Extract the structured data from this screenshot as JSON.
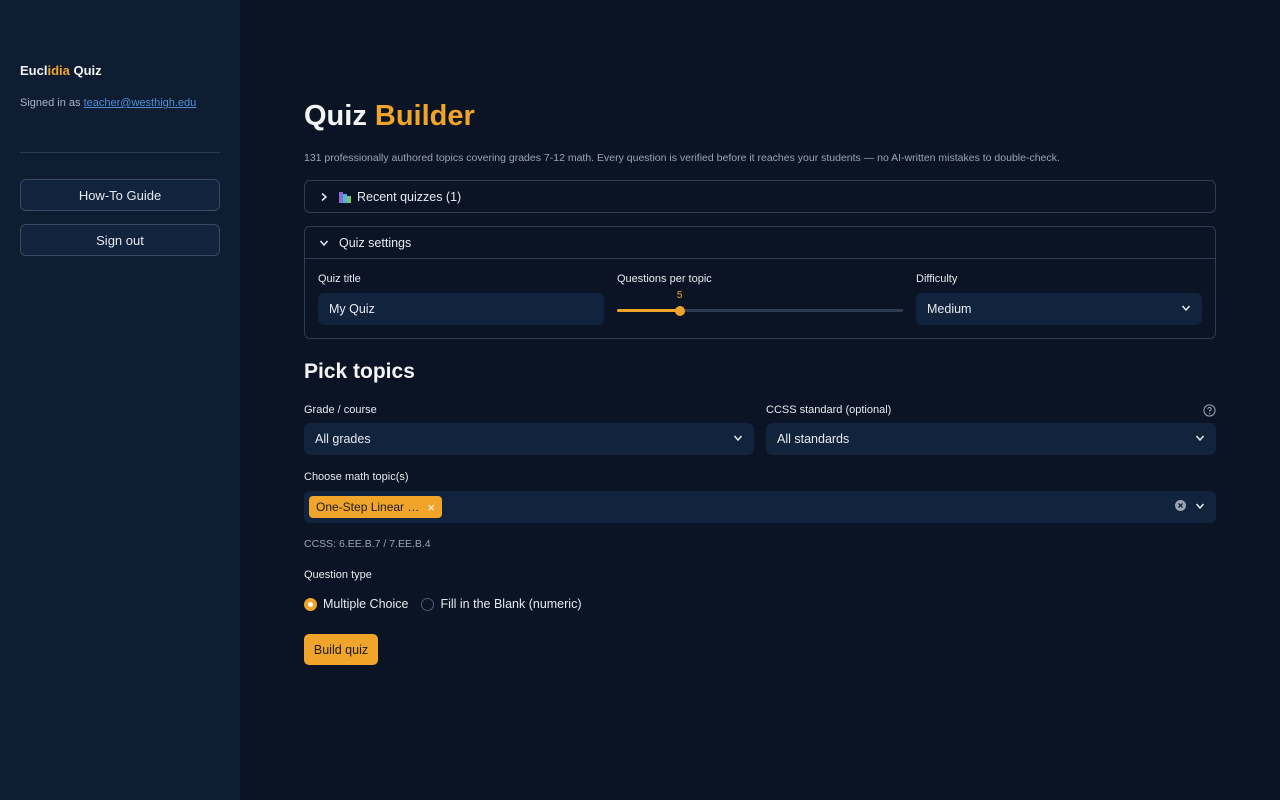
{
  "sidebar": {
    "brand_part1": "Eucl",
    "brand_accent": "idia",
    "brand_part2": " Quiz",
    "signed_prefix": "Signed in as ",
    "signed_email": "teacher@westhigh.edu",
    "howto_label": "How-To Guide",
    "signout_label": "Sign out"
  },
  "header": {
    "title_main": "Quiz ",
    "title_accent": "Builder",
    "subtitle": "131 professionally authored topics covering grades 7-12 math. Every question is verified before it reaches your students — no AI-written mistakes to double-check."
  },
  "recent": {
    "label": "Recent quizzes (1)"
  },
  "settings": {
    "label": "Quiz settings",
    "quiz_title_label": "Quiz title",
    "quiz_title_value": "My Quiz",
    "questions_label": "Questions per topic",
    "questions_value": "5",
    "questions_fraction": 0.22,
    "difficulty_label": "Difficulty",
    "difficulty_value": "Medium"
  },
  "topics": {
    "section_title": "Pick topics",
    "grade_label": "Grade / course",
    "grade_value": "All grades",
    "ccss_label": "CCSS standard (optional)",
    "ccss_value": "All standards",
    "choose_label": "Choose math topic(s)",
    "chip_label": "One-Step Linear …",
    "chip_remove": "×",
    "ccss_note": "CCSS: 6.EE.B.7 / 7.EE.B.4"
  },
  "question_type": {
    "label": "Question type",
    "option_mc": "Multiple Choice",
    "option_fill": "Fill in the Blank (numeric)"
  },
  "build": {
    "label": "Build quiz"
  },
  "colors": {
    "accent": "#f0a52a",
    "sidebar_bg": "#0f1d33",
    "main_bg": "#0b1424",
    "input_bg": "#12233d",
    "link": "#4f8fd6"
  }
}
